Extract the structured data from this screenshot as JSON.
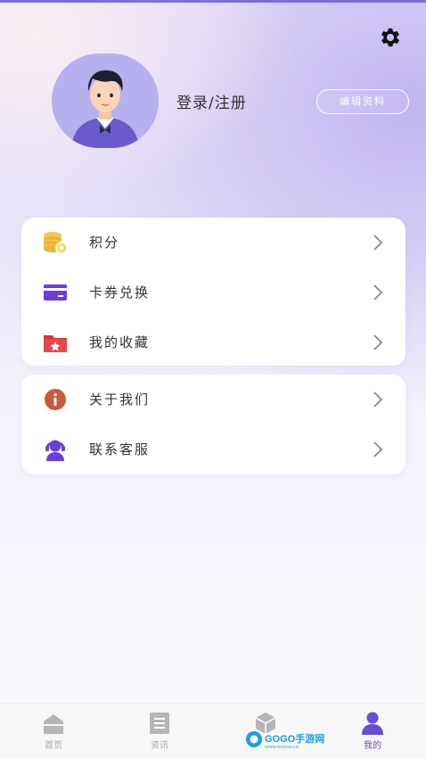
{
  "header": {
    "login_label": "登录/注册",
    "edit_label": "编辑资料"
  },
  "menu_group1": [
    {
      "label": "积分",
      "icon": "coins-icon"
    },
    {
      "label": "卡券兑换",
      "icon": "card-icon"
    },
    {
      "label": "我的收藏",
      "icon": "favorites-folder-icon"
    }
  ],
  "menu_group2": [
    {
      "label": "关于我们",
      "icon": "info-icon"
    },
    {
      "label": "联系客服",
      "icon": "customer-service-icon"
    }
  ],
  "tabbar": [
    {
      "label": "首页",
      "icon": "home-icon"
    },
    {
      "label": "资讯",
      "icon": "news-icon"
    },
    {
      "label": "",
      "icon": "cube-icon"
    },
    {
      "label": "我的",
      "icon": "profile-icon",
      "active": true
    }
  ],
  "watermark": {
    "text": "GOGO手游网",
    "sub": "WWW.GOGO3.CN"
  },
  "colors": {
    "accent": "#6a4bd6",
    "tab_inactive": "#aaaaaa"
  }
}
